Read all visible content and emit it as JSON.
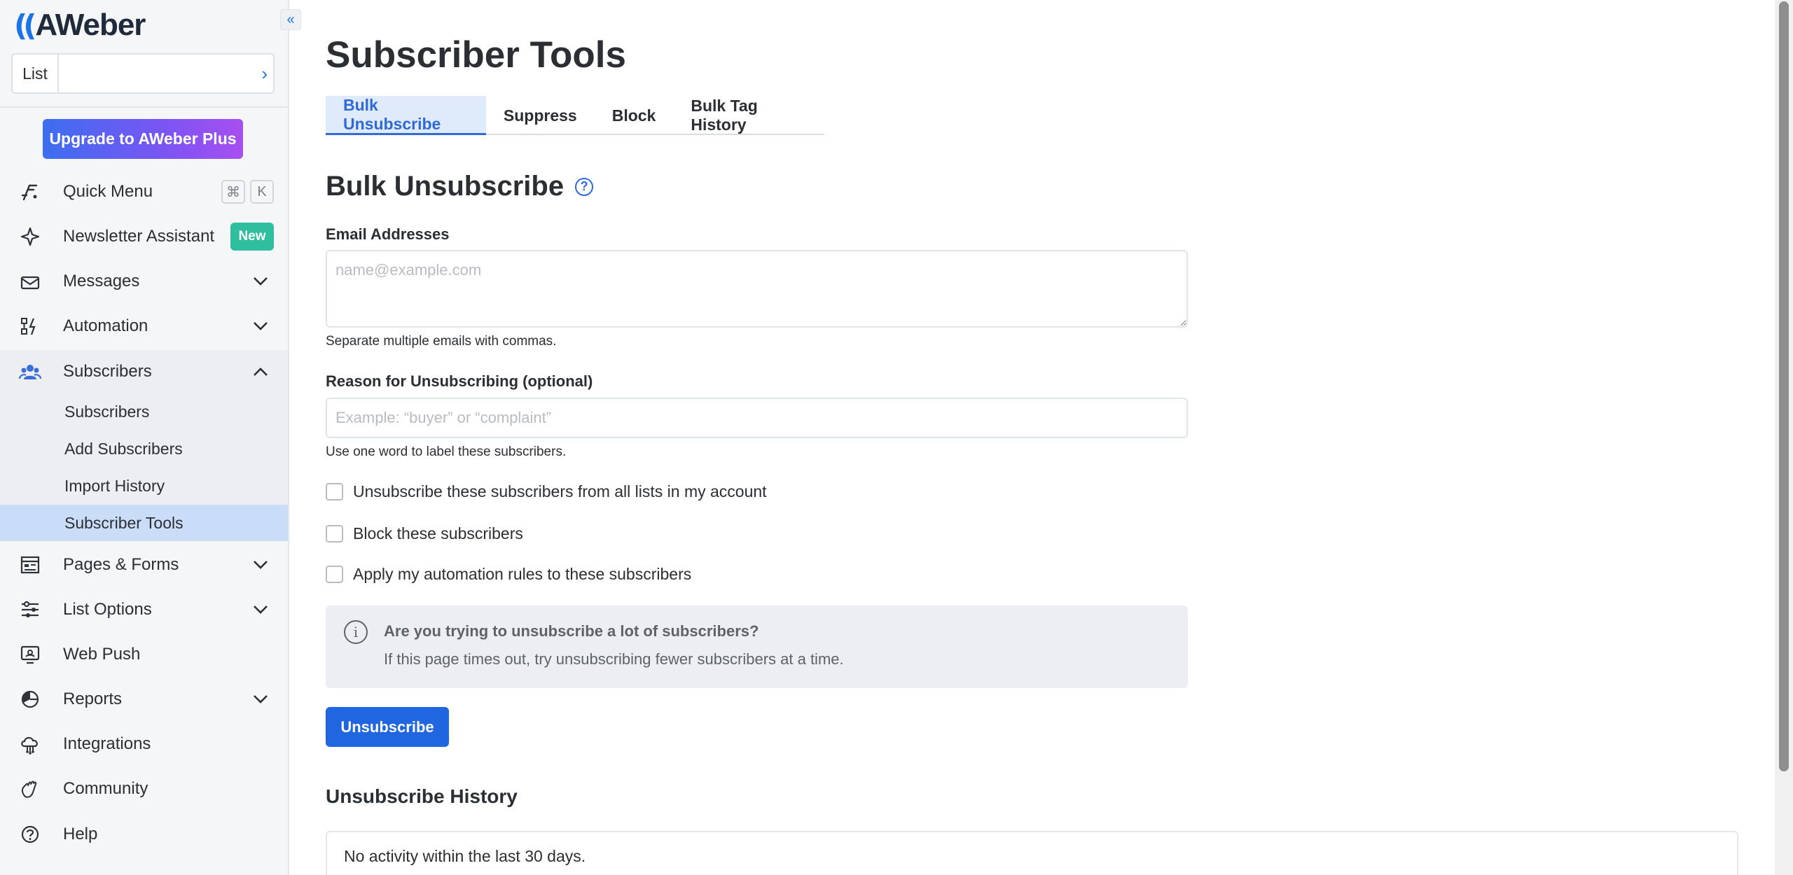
{
  "sidebar": {
    "logo_text": "AWeber",
    "collapse_icon": "double-chevron-left-icon",
    "list_label": "List",
    "upgrade_label": "Upgrade to AWeber Plus",
    "quick_menu": {
      "label": "Quick Menu",
      "kbd1": "⌘",
      "kbd2": "K"
    },
    "newsletter": {
      "label": "Newsletter Assistant",
      "badge": "New"
    },
    "messages": "Messages",
    "automation": "Automation",
    "subscribers": "Subscribers",
    "sub_items": [
      "Subscribers",
      "Add Subscribers",
      "Import History",
      "Subscriber Tools"
    ],
    "pages_forms": "Pages & Forms",
    "list_options": "List Options",
    "web_push": "Web Push",
    "reports": "Reports",
    "integrations": "Integrations",
    "community": "Community",
    "help": "Help"
  },
  "main": {
    "title": "Subscriber Tools",
    "tabs": [
      "Bulk Unsubscribe",
      "Suppress",
      "Block",
      "Bulk Tag History"
    ],
    "section_title": "Bulk Unsubscribe",
    "email_label": "Email Addresses",
    "email_placeholder": "name@example.com",
    "email_hint": "Separate multiple emails with commas.",
    "reason_label": "Reason for Unsubscribing (optional)",
    "reason_placeholder": "Example: “buyer” or “complaint”",
    "reason_hint": "Use one word to label these subscribers.",
    "checkboxes": [
      "Unsubscribe these subscribers from all lists in my account",
      "Block these subscribers",
      "Apply my automation rules to these subscribers"
    ],
    "info_title": "Are you trying to unsubscribe a lot of subscribers?",
    "info_body": "If this page times out, try unsubscribing fewer subscribers at a time.",
    "submit_label": "Unsubscribe",
    "history_title": "Unsubscribe History",
    "history_empty": "No activity within the last 30 days."
  },
  "colors": {
    "accent": "#1f66e0",
    "active_nav_bg": "#c9dcf8",
    "new_badge": "#2fbf9f"
  }
}
